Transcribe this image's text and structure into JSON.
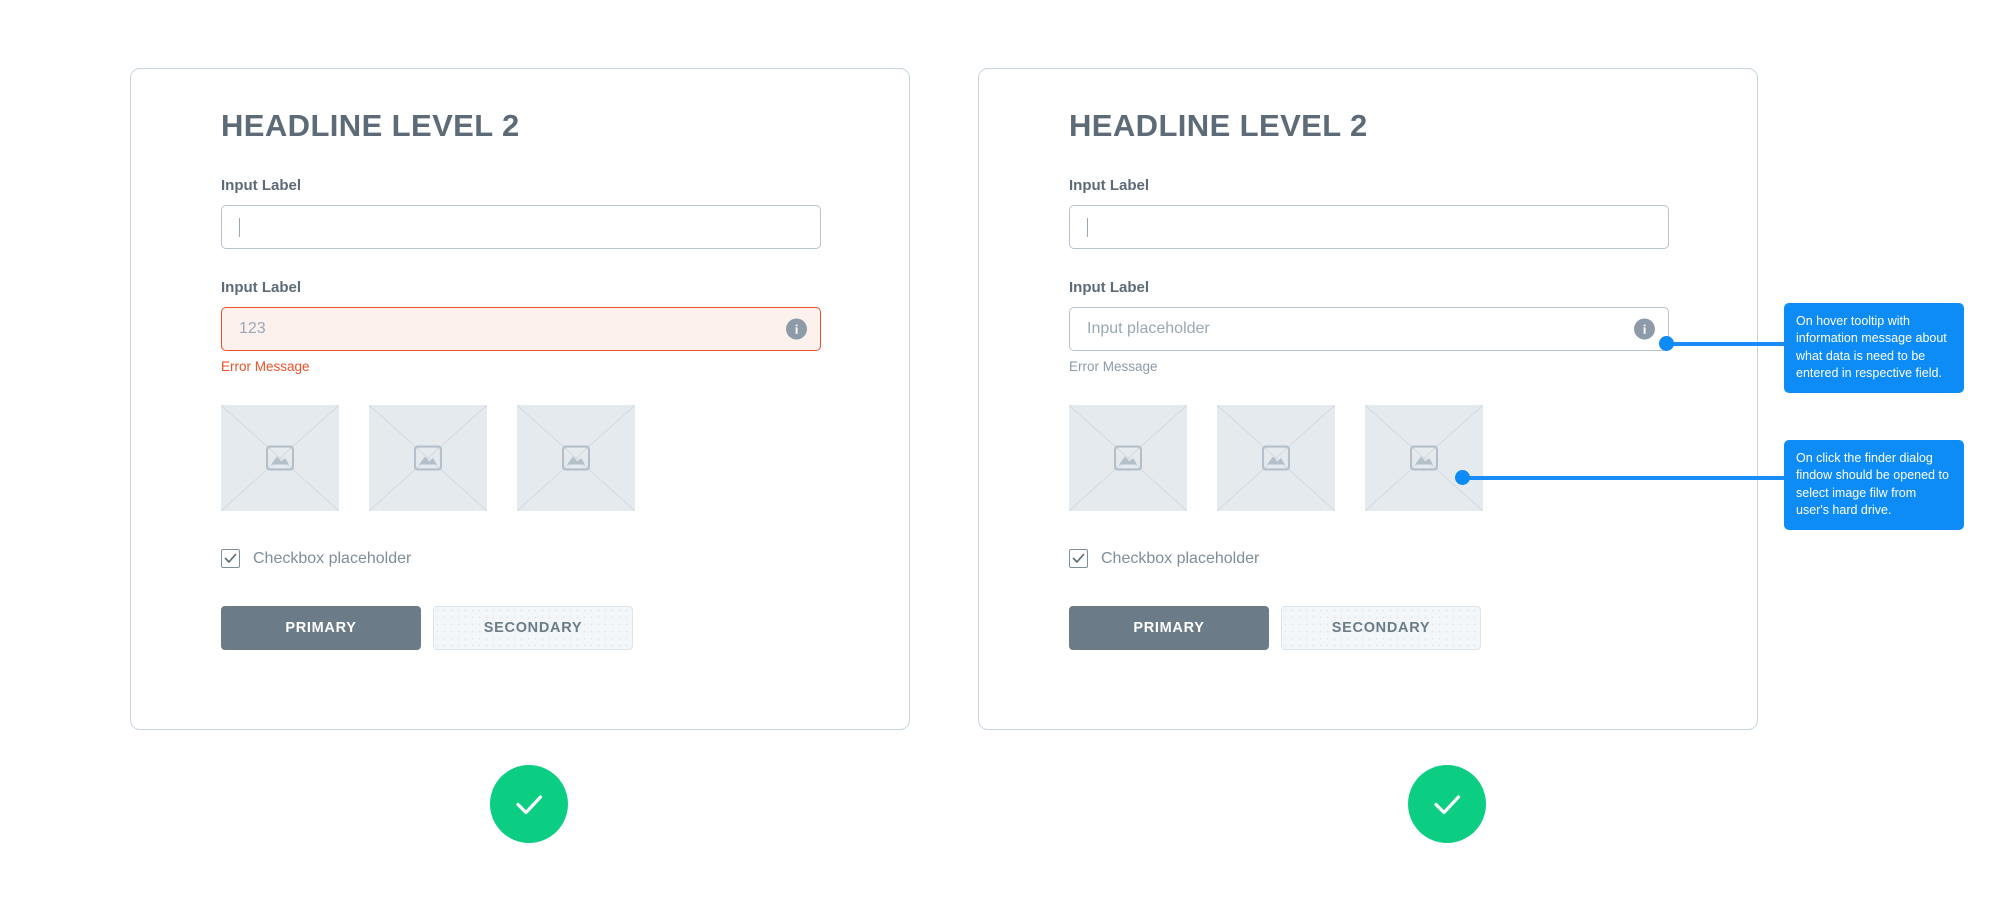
{
  "cards": [
    {
      "id": "left",
      "headline": "HEADLINE LEVEL 2",
      "fields": [
        {
          "label": "Input Label",
          "value": "",
          "placeholder": "",
          "state": "focused",
          "has_info_icon": false,
          "helper": ""
        },
        {
          "label": "Input Label",
          "value": "",
          "placeholder": "123",
          "state": "error",
          "has_info_icon": true,
          "helper": "Error Message"
        }
      ],
      "thumbnails": [
        {
          "icon": "image-placeholder-icon"
        },
        {
          "icon": "image-placeholder-icon"
        },
        {
          "icon": "image-placeholder-icon"
        }
      ],
      "checkbox": {
        "label": "Checkbox placeholder",
        "checked": true
      },
      "buttons": {
        "primary": "PRIMARY",
        "secondary": "SECONDARY"
      }
    },
    {
      "id": "right",
      "headline": "HEADLINE LEVEL 2",
      "fields": [
        {
          "label": "Input Label",
          "value": "",
          "placeholder": "",
          "state": "focused",
          "has_info_icon": false,
          "helper": ""
        },
        {
          "label": "Input Label",
          "value": "",
          "placeholder": "Input placeholder",
          "state": "default",
          "has_info_icon": true,
          "helper": "Error Message"
        }
      ],
      "thumbnails": [
        {
          "icon": "image-placeholder-icon"
        },
        {
          "icon": "image-placeholder-icon"
        },
        {
          "icon": "image-placeholder-icon"
        }
      ],
      "checkbox": {
        "label": "Checkbox placeholder",
        "checked": true
      },
      "buttons": {
        "primary": "PRIMARY",
        "secondary": "SECONDARY"
      }
    }
  ],
  "annotations": [
    {
      "id": "tooltip-1",
      "text": "On hover tooltip with information message about what data is need to be entered in respective field.",
      "anchor": "info-icon-right-field-2"
    },
    {
      "id": "tooltip-2",
      "text": "On click the finder dialog findow should be opened to select image filw from user's hard drive.",
      "anchor": "thumbnail-right-3"
    }
  ],
  "success_badges": [
    {
      "id": "success-left",
      "icon": "check-icon"
    },
    {
      "id": "success-right",
      "icon": "check-icon"
    }
  ],
  "colors": {
    "accent_blue": "#0d8bf7",
    "error_red": "#ec512a",
    "success_green": "#0bce83",
    "text_slate": "#5d6b78",
    "border_gray": "#c9d6e0"
  }
}
